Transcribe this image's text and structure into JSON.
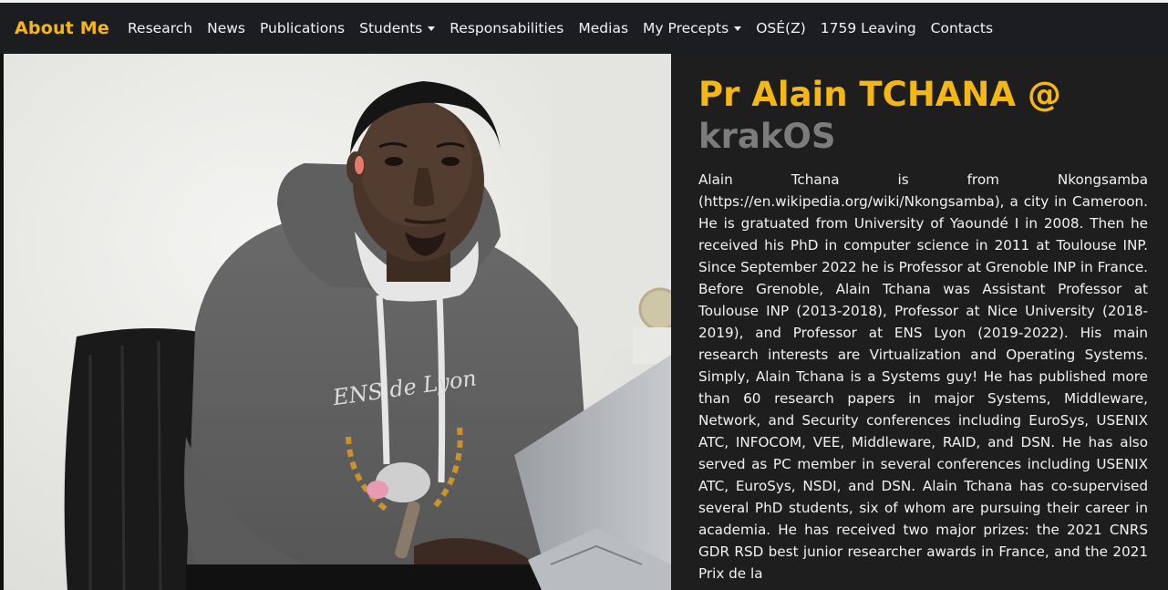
{
  "navbar": {
    "brand": "About Me",
    "items": [
      {
        "label": "Research",
        "dropdown": false
      },
      {
        "label": "News",
        "dropdown": false
      },
      {
        "label": "Publications",
        "dropdown": false
      },
      {
        "label": "Students",
        "dropdown": true
      },
      {
        "label": "Responsabilities",
        "dropdown": false
      },
      {
        "label": "Medias",
        "dropdown": false
      },
      {
        "label": "My Precepts",
        "dropdown": true
      },
      {
        "label": "OSÉ(Z)",
        "dropdown": false
      },
      {
        "label": "1759 Leaving",
        "dropdown": false
      },
      {
        "label": "Contacts",
        "dropdown": false
      }
    ]
  },
  "profile": {
    "title_name": "Pr Alain TCHANA @",
    "title_team": "krakOS",
    "bio": "Alain Tchana is from Nkongsamba (https://en.wikipedia.org/wiki/Nkongsamba), a city in Cameroon. He is gratuated from University of Yaoundé I in 2008. Then he received his PhD in computer science in 2011 at Toulouse INP. Since September 2022 he is Professor at Grenoble INP in France. Before Grenoble, Alain Tchana was Assistant Professor at Toulouse INP (2013-2018), Professor at Nice University (2018-2019), and Professor at ENS Lyon (2019-2022). His main research interests are Virtualization and Operating Systems. Simply, Alain Tchana is a Systems guy! He has published more than 60 research papers in major Systems, Middleware, Network, and Security conferences including EuroSys, USENIX ATC, INFOCOM, VEE, Middleware, RAID, and DSN. He has also served as PC member in several conferences including USENIX ATC, EuroSys, NSDI, and DSN. Alain Tchana has co-supervised several PhD students, six of whom are pursuing their career in academia. He has received two major prizes: the 2021 CNRS GDR RSD best junior researcher awards in France, and the 2021 Prix de la",
    "photo_shirt_text": "ENS de Lyon"
  },
  "colors": {
    "accent": "#f5b714",
    "navbar_bg": "#1b1d21",
    "panel_bg": "#1e1e1e",
    "subtitle": "#7c7c7c"
  }
}
